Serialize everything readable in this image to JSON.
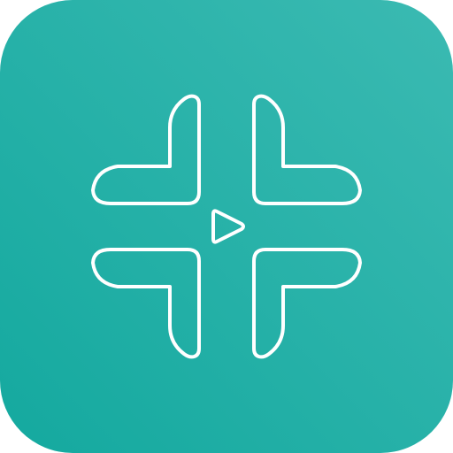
{
  "icon": {
    "name": "app-icon",
    "glyph": "crop-corners-with-play-icon",
    "colors": {
      "background_start": "#3bbab2",
      "background_end": "#14a99f",
      "stroke": "#ffffff"
    }
  }
}
